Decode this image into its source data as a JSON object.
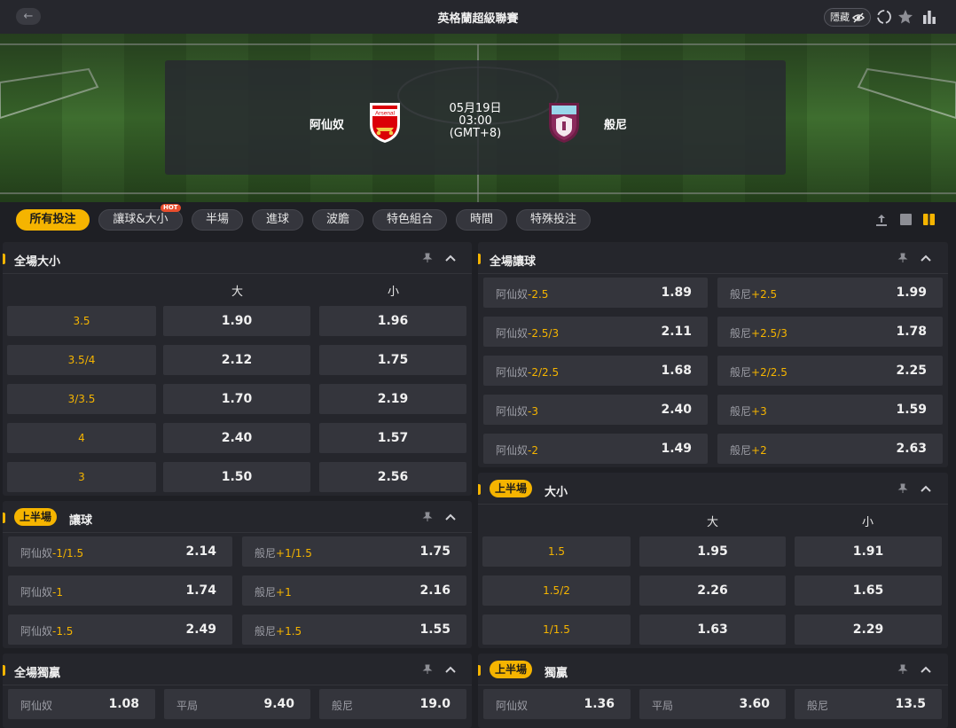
{
  "header": {
    "back_icon": "arrow-left-icon",
    "title": "英格蘭超級聯賽",
    "hide_label": "隱藏",
    "icons": [
      "eye-off-icon",
      "refresh-icon",
      "star-icon",
      "stats-icon"
    ]
  },
  "match": {
    "home": "阿仙奴",
    "away": "般尼",
    "date": "05月19日",
    "time": "03:00",
    "timezone": "(GMT+8)",
    "home_crest_text": "Arsenal"
  },
  "filters": [
    {
      "label": "所有投注",
      "active": true
    },
    {
      "label": "讓球&大小",
      "hot": "HOT"
    },
    {
      "label": "半場"
    },
    {
      "label": "進球"
    },
    {
      "label": "波膽"
    },
    {
      "label": "特色組合"
    },
    {
      "label": "時間"
    },
    {
      "label": "特殊投注"
    }
  ],
  "colors": {
    "accent": "#f5b400",
    "panel": "#25262c",
    "cell": "#34353c",
    "background": "#1e1f24"
  },
  "markets": {
    "ft_ou": {
      "title": "全場大小",
      "over": "大",
      "under": "小",
      "rows": [
        {
          "line": "3.5",
          "over": "1.90",
          "under": "1.96"
        },
        {
          "line": "3.5/4",
          "over": "2.12",
          "under": "1.75"
        },
        {
          "line": "3/3.5",
          "over": "1.70",
          "under": "2.19"
        },
        {
          "line": "4",
          "over": "2.40",
          "under": "1.57"
        },
        {
          "line": "3",
          "over": "1.50",
          "under": "2.56"
        }
      ]
    },
    "ft_hdp": {
      "title": "全場讓球",
      "rows": [
        {
          "home": "阿仙奴",
          "home_line": "-2.5",
          "home_odd": "1.89",
          "away": "般尼",
          "away_line": "+2.5",
          "away_odd": "1.99"
        },
        {
          "home": "阿仙奴",
          "home_line": "-2.5/3",
          "home_odd": "2.11",
          "away": "般尼",
          "away_line": "+2.5/3",
          "away_odd": "1.78"
        },
        {
          "home": "阿仙奴",
          "home_line": "-2/2.5",
          "home_odd": "1.68",
          "away": "般尼",
          "away_line": "+2/2.5",
          "away_odd": "2.25"
        },
        {
          "home": "阿仙奴",
          "home_line": "-3",
          "home_odd": "2.40",
          "away": "般尼",
          "away_line": "+3",
          "away_odd": "1.59"
        },
        {
          "home": "阿仙奴",
          "home_line": "-2",
          "home_odd": "1.49",
          "away": "般尼",
          "away_line": "+2",
          "away_odd": "2.63"
        }
      ]
    },
    "fh_hdp": {
      "badge": "上半場",
      "title": "讓球",
      "rows": [
        {
          "home": "阿仙奴",
          "home_line": "-1/1.5",
          "home_odd": "2.14",
          "away": "般尼",
          "away_line": "+1/1.5",
          "away_odd": "1.75"
        },
        {
          "home": "阿仙奴",
          "home_line": "-1",
          "home_odd": "1.74",
          "away": "般尼",
          "away_line": "+1",
          "away_odd": "2.16"
        },
        {
          "home": "阿仙奴",
          "home_line": "-1.5",
          "home_odd": "2.49",
          "away": "般尼",
          "away_line": "+1.5",
          "away_odd": "1.55"
        }
      ]
    },
    "fh_ou": {
      "badge": "上半場",
      "title": "大小",
      "over": "大",
      "under": "小",
      "rows": [
        {
          "line": "1.5",
          "over": "1.95",
          "under": "1.91"
        },
        {
          "line": "1.5/2",
          "over": "2.26",
          "under": "1.65"
        },
        {
          "line": "1/1.5",
          "over": "1.63",
          "under": "2.29"
        }
      ]
    },
    "ft_1x2": {
      "title": "全場獨贏",
      "home": "阿仙奴",
      "home_odd": "1.08",
      "draw": "平局",
      "draw_odd": "9.40",
      "away": "般尼",
      "away_odd": "19.0"
    },
    "fh_1x2": {
      "badge": "上半場",
      "title": "獨贏",
      "home": "阿仙奴",
      "home_odd": "1.36",
      "draw": "平局",
      "draw_odd": "3.60",
      "away": "般尼",
      "away_odd": "13.5"
    }
  }
}
